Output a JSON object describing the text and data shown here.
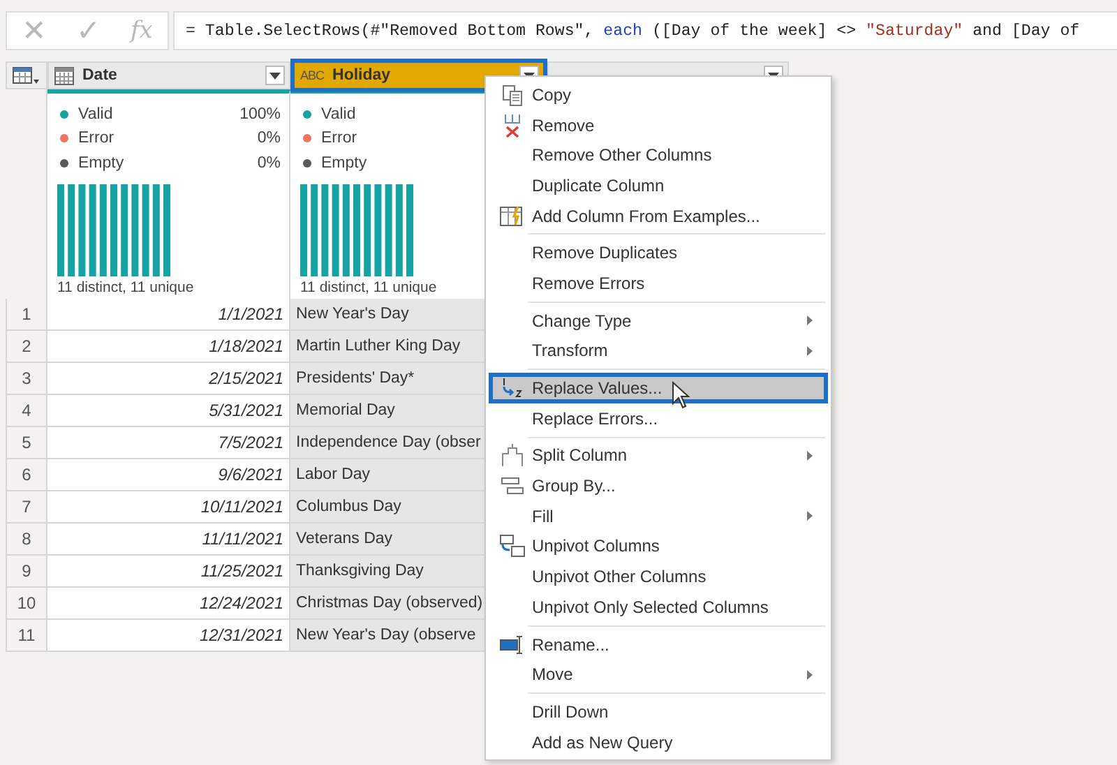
{
  "formula_bar": {
    "cancel": "✕",
    "confirm": "✓",
    "fx": "fx",
    "formula": [
      {
        "text": "= Table.SelectRows(#\"Removed Bottom Rows\", ",
        "kind": "plain"
      },
      {
        "text": "each",
        "kind": "keyword"
      },
      {
        "text": " ([Day of the week] <> ",
        "kind": "plain"
      },
      {
        "text": "\"Saturday\"",
        "kind": "string"
      },
      {
        "text": " and [Day of",
        "kind": "plain"
      }
    ]
  },
  "columns": [
    {
      "name": "Date",
      "kind": "date",
      "selected": false
    },
    {
      "name": "Holiday",
      "kind": "text",
      "type_label": "ABC",
      "selected": true
    }
  ],
  "profiles": [
    {
      "stats": [
        {
          "label": "Valid",
          "percent": "100%",
          "color": "#16a3a3"
        },
        {
          "label": "Error",
          "percent": "0%",
          "color": "#f0735f"
        },
        {
          "label": "Empty",
          "percent": "0%",
          "color": "#595959"
        }
      ],
      "summary": "11 distinct, 11 unique"
    },
    {
      "stats": [
        {
          "label": "Valid",
          "color": "#16a3a3"
        },
        {
          "label": "Error",
          "color": "#f0735f"
        },
        {
          "label": "Empty",
          "color": "#595959"
        }
      ],
      "summary": "11 distinct, 11 unique"
    }
  ],
  "rows": [
    {
      "num": "1",
      "date": "1/1/2021",
      "holiday": "New Year's Day"
    },
    {
      "num": "2",
      "date": "1/18/2021",
      "holiday": "Martin Luther King Day"
    },
    {
      "num": "3",
      "date": "2/15/2021",
      "holiday": "Presidents' Day*"
    },
    {
      "num": "4",
      "date": "5/31/2021",
      "holiday": "Memorial Day"
    },
    {
      "num": "5",
      "date": "7/5/2021",
      "holiday": "Independence Day (obser"
    },
    {
      "num": "6",
      "date": "9/6/2021",
      "holiday": "Labor Day"
    },
    {
      "num": "7",
      "date": "10/11/2021",
      "holiday": "Columbus Day"
    },
    {
      "num": "8",
      "date": "11/11/2021",
      "holiday": "Veterans Day"
    },
    {
      "num": "9",
      "date": "11/25/2021",
      "holiday": "Thanksgiving Day"
    },
    {
      "num": "10",
      "date": "12/24/2021",
      "holiday": "Christmas Day (observed)"
    },
    {
      "num": "11",
      "date": "12/31/2021",
      "holiday": "New Year's Day (observe"
    }
  ],
  "context_menu": {
    "groups": [
      [
        {
          "label": "Copy",
          "submenu": false,
          "selected": false
        },
        {
          "label": "Remove",
          "submenu": false,
          "selected": false
        },
        {
          "label": "Remove Other Columns",
          "submenu": false,
          "selected": false
        },
        {
          "label": "Duplicate Column",
          "submenu": false,
          "selected": false
        },
        {
          "label": "Add Column From Examples...",
          "submenu": false,
          "selected": false
        }
      ],
      [
        {
          "label": "Remove Duplicates",
          "submenu": false,
          "selected": false
        },
        {
          "label": "Remove Errors",
          "submenu": false,
          "selected": false
        }
      ],
      [
        {
          "label": "Change Type",
          "submenu": true,
          "selected": false
        },
        {
          "label": "Transform",
          "submenu": true,
          "selected": false
        }
      ],
      [
        {
          "label": "Replace Values...",
          "submenu": false,
          "selected": true
        },
        {
          "label": "Replace Errors...",
          "submenu": false,
          "selected": false
        }
      ],
      [
        {
          "label": "Split Column",
          "submenu": true,
          "selected": false
        },
        {
          "label": "Group By...",
          "submenu": false,
          "selected": false
        },
        {
          "label": "Fill",
          "submenu": true,
          "selected": false
        },
        {
          "label": "Unpivot Columns",
          "submenu": false,
          "selected": false
        },
        {
          "label": "Unpivot Other Columns",
          "submenu": false,
          "selected": false
        },
        {
          "label": "Unpivot Only Selected Columns",
          "submenu": false,
          "selected": false
        }
      ],
      [
        {
          "label": "Rename...",
          "submenu": false,
          "selected": false
        },
        {
          "label": "Move",
          "submenu": true,
          "selected": false
        }
      ],
      [
        {
          "label": "Drill Down",
          "submenu": false,
          "selected": false
        },
        {
          "label": "Add as New Query",
          "submenu": false,
          "selected": false
        }
      ]
    ]
  }
}
